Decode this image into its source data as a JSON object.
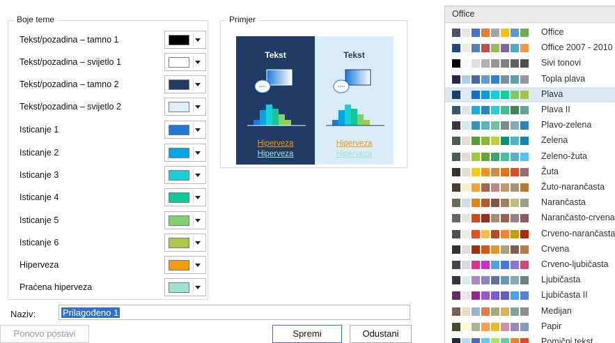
{
  "theme_colors": {
    "legend": "Boje teme",
    "rows": [
      {
        "label": "Tekst/pozadina – tamno 1",
        "color": "#000000"
      },
      {
        "label": "Tekst/pozadina – svijetlo 1",
        "color": "#ffffff"
      },
      {
        "label": "Tekst/pozadina – tamno 2",
        "color": "#1f3b66"
      },
      {
        "label": "Tekst/pozadina – svijetlo 2",
        "color": "#ddeef9"
      },
      {
        "label": "Isticanje 1",
        "color": "#1d7ad6"
      },
      {
        "label": "Isticanje 2",
        "color": "#00a6e6"
      },
      {
        "label": "Isticanje 3",
        "color": "#18cfd6"
      },
      {
        "label": "Isticanje 4",
        "color": "#12c79a"
      },
      {
        "label": "Isticanje 5",
        "color": "#7fd36e"
      },
      {
        "label": "Isticanje 6",
        "color": "#a9c94a"
      },
      {
        "label": "Hiperveza",
        "color": "#f59a0a"
      },
      {
        "label": "Praćena hiperveza",
        "color": "#9fe3d8"
      }
    ]
  },
  "sample": {
    "legend": "Primjer",
    "text_label": "Tekst",
    "hyperlink": "Hiperveza",
    "followed_hyperlink": "Hiperveza"
  },
  "name_field": {
    "label": "Naziv:",
    "value": "Prilagođeno 1"
  },
  "buttons": {
    "reset": "Ponovo postavi",
    "save": "Spremi",
    "cancel": "Odustani"
  },
  "scheme_list": {
    "header": "Office",
    "items": [
      {
        "name": "Office",
        "colors": [
          "#44546a",
          "#e7e6e6",
          "#4472c4",
          "#ed7d31",
          "#a5a5a5",
          "#ffc000",
          "#5b9bd5",
          "#70ad47"
        ]
      },
      {
        "name": "Office 2007 - 2010",
        "colors": [
          "#1f497d",
          "#eeece1",
          "#4f81bd",
          "#c0504d",
          "#9bbb59",
          "#8064a2",
          "#4bacc6",
          "#f79646"
        ]
      },
      {
        "name": "Sivi tonovi",
        "colors": [
          "#000000",
          "#f8f8f8",
          "#dddddd",
          "#b2b2b2",
          "#969696",
          "#808080",
          "#5f5f5f",
          "#4d4d4d"
        ]
      },
      {
        "name": "Topla plava",
        "colors": [
          "#242852",
          "#acccea",
          "#4a66ac",
          "#629dd1",
          "#297fd5",
          "#7f8fa9",
          "#5aa2ae",
          "#9d90a0"
        ]
      },
      {
        "name": "Plava",
        "colors": [
          "#17406d",
          "#dbeff9",
          "#0f6fc6",
          "#009dd9",
          "#0bd0d9",
          "#10cf9b",
          "#7cca62",
          "#a5c249"
        ],
        "selected": true
      },
      {
        "name": "Plava II",
        "colors": [
          "#335b74",
          "#dfe3e5",
          "#1cade4",
          "#2683c6",
          "#27ced7",
          "#42ba97",
          "#3e8853",
          "#62a39f"
        ]
      },
      {
        "name": "Plavo-zelena",
        "colors": [
          "#373545",
          "#ceeaf6",
          "#3494ba",
          "#58b6c0",
          "#75bda7",
          "#7a8c8e",
          "#84acb6",
          "#2683c6"
        ]
      },
      {
        "name": "Zelena",
        "colors": [
          "#455f51",
          "#e3ded1",
          "#549e39",
          "#8ab833",
          "#c0cf3a",
          "#029676",
          "#4ab5c4",
          "#0989b1"
        ]
      },
      {
        "name": "Zeleno-žuta",
        "colors": [
          "#455f51",
          "#e3ded1",
          "#99cb38",
          "#63a537",
          "#37a76f",
          "#44c1a3",
          "#4eb3cf",
          "#51c3f9"
        ]
      },
      {
        "name": "Žuta",
        "colors": [
          "#39302a",
          "#e5dec9",
          "#ffca08",
          "#f8931d",
          "#ce8d3e",
          "#ec7016",
          "#e64823",
          "#9c6a6a"
        ]
      },
      {
        "name": "Žuto-narančasta",
        "colors": [
          "#4e3b30",
          "#fbeec9",
          "#f0a22e",
          "#a5644e",
          "#b58b80",
          "#c3986d",
          "#a19574",
          "#c17529"
        ]
      },
      {
        "name": "Narančasta",
        "colors": [
          "#637052",
          "#ccddea",
          "#e48312",
          "#bd582c",
          "#865640",
          "#9b8357",
          "#c2bc80",
          "#94a088"
        ]
      },
      {
        "name": "Narančasto-crvena",
        "colors": [
          "#696464",
          "#e9e5dc",
          "#d34817",
          "#9b2d1f",
          "#a28e6a",
          "#956251",
          "#918485",
          "#855d5d"
        ]
      },
      {
        "name": "Crveno-narančasta",
        "colors": [
          "#505046",
          "#eeece1",
          "#e84c22",
          "#ffbd47",
          "#b64926",
          "#ff8427",
          "#cc9900",
          "#b22600"
        ]
      },
      {
        "name": "Crvena",
        "colors": [
          "#323232",
          "#e3ded1",
          "#a5300f",
          "#d55816",
          "#e19825",
          "#b19c7d",
          "#7f5f52",
          "#b27d49"
        ]
      },
      {
        "name": "Crveno-ljubičasta",
        "colors": [
          "#454551",
          "#d8d9dc",
          "#e32d91",
          "#c830cc",
          "#4ea6dc",
          "#4775e7",
          "#8971e1",
          "#d54773"
        ]
      },
      {
        "name": "Ljubičasta",
        "colors": [
          "#373545",
          "#dceaf1",
          "#ad84c6",
          "#8784c7",
          "#5d739a",
          "#6997af",
          "#84acb6",
          "#6f8183"
        ]
      },
      {
        "name": "Ljubičasta II",
        "colors": [
          "#632e62",
          "#eae5eb",
          "#92278f",
          "#9b57d3",
          "#755dd9",
          "#665eb8",
          "#45a5ed",
          "#5982db"
        ]
      },
      {
        "name": "Medijan",
        "colors": [
          "#775f55",
          "#ebddc3",
          "#94b6d2",
          "#dd8047",
          "#a5ab81",
          "#d8b25c",
          "#7ba79d",
          "#968c8c"
        ]
      },
      {
        "name": "Papir",
        "colors": [
          "#444d26",
          "#fefac9",
          "#a5b592",
          "#f3a447",
          "#e7bc29",
          "#d092a7",
          "#9c85c0",
          "#809ec2"
        ]
      },
      {
        "name": "Pomični tekst",
        "colors": [
          "#212745",
          "#b4dcfa",
          "#4e67c8",
          "#5eccf3",
          "#a7ea52",
          "#5dceaf",
          "#ff8021",
          "#f14124"
        ]
      }
    ]
  }
}
